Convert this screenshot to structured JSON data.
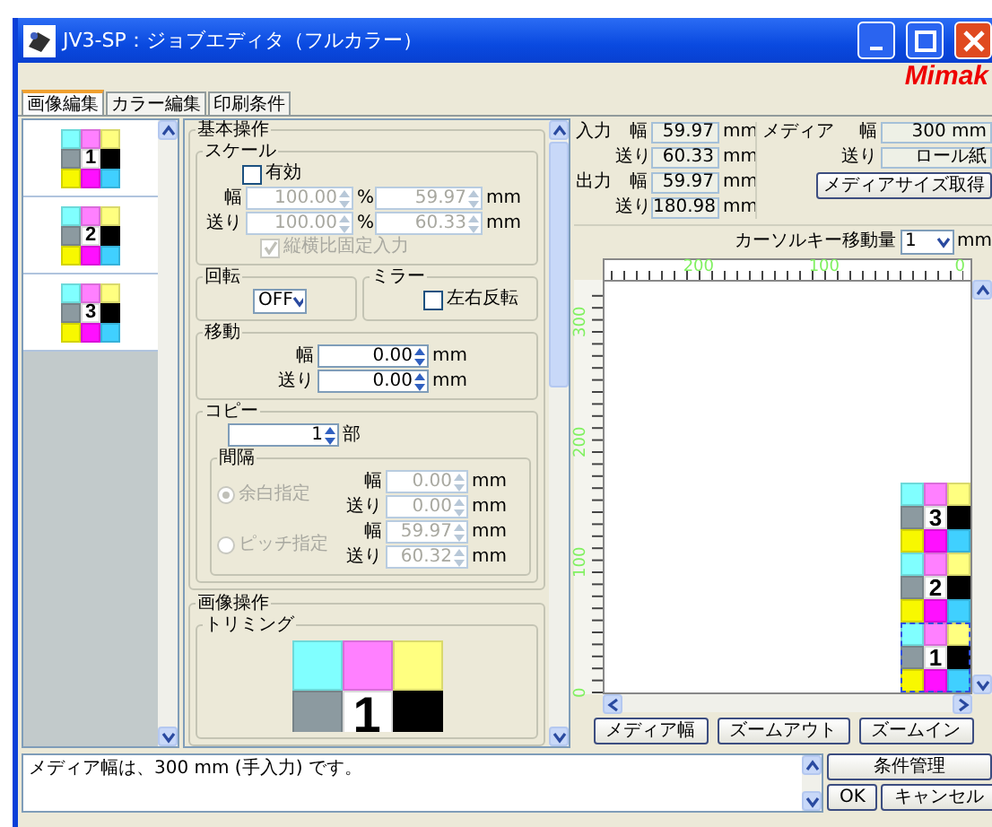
{
  "window": {
    "title": "JV3-SP：ジョブエディタ（フルカラー）",
    "logo": "Mimak"
  },
  "tabs": [
    {
      "label": "画像編集",
      "selected": true
    },
    {
      "label": "カラー編集",
      "selected": false
    },
    {
      "label": "印刷条件",
      "selected": false
    }
  ],
  "thumbnails": [
    {
      "number": "1"
    },
    {
      "number": "2"
    },
    {
      "number": "3"
    }
  ],
  "basic_ops": {
    "title": "基本操作",
    "scale": {
      "title": "スケール",
      "enabled": {
        "label": "有効",
        "checked": false
      },
      "rows": [
        {
          "label": "幅",
          "percent": "100.00",
          "percent_unit": "%",
          "value": "59.97",
          "unit": "mm"
        },
        {
          "label": "送り",
          "percent": "100.00",
          "percent_unit": "%",
          "value": "60.33",
          "unit": "mm"
        }
      ],
      "aspect_lock": {
        "label": "縦横比固定入力",
        "checked": true
      }
    },
    "rotation": {
      "title": "回転",
      "value": "OFF"
    },
    "mirror": {
      "title": "ミラー",
      "checkbox": {
        "label": "左右反転",
        "checked": false
      }
    },
    "move": {
      "title": "移動",
      "rows": [
        {
          "label": "幅",
          "value": "0.00",
          "unit": "mm"
        },
        {
          "label": "送り",
          "value": "0.00",
          "unit": "mm"
        }
      ]
    },
    "copy": {
      "title": "コピー",
      "count": "1",
      "count_unit": "部",
      "interval": {
        "title": "間隔",
        "options": [
          {
            "label": "余白指定",
            "selected": true,
            "rows": [
              {
                "label": "幅",
                "value": "0.00",
                "unit": "mm"
              },
              {
                "label": "送り",
                "value": "0.00",
                "unit": "mm"
              }
            ]
          },
          {
            "label": "ピッチ指定",
            "selected": false,
            "rows": [
              {
                "label": "幅",
                "value": "59.97",
                "unit": "mm"
              },
              {
                "label": "送り",
                "value": "60.32",
                "unit": "mm"
              }
            ]
          }
        ]
      }
    }
  },
  "image_ops": {
    "title": "画像操作",
    "trimming": {
      "title": "トリミング",
      "number": "1"
    }
  },
  "size_info": {
    "groups": [
      {
        "label": "入力",
        "rows": [
          {
            "label": "幅",
            "value": "59.97",
            "unit": "mm"
          },
          {
            "label": "送り",
            "value": "60.33",
            "unit": "mm"
          }
        ]
      },
      {
        "label": "出力",
        "rows": [
          {
            "label": "幅",
            "value": "59.97",
            "unit": "mm"
          },
          {
            "label": "送り",
            "value": "180.98",
            "unit": "mm"
          }
        ]
      }
    ],
    "media": {
      "label": "メディア",
      "rows": [
        {
          "label": "幅",
          "value": "300 mm"
        },
        {
          "label": "送り",
          "value": "ロール紙"
        }
      ],
      "button": "メディアサイズ取得"
    }
  },
  "cursor_step": {
    "label": "カーソルキー移動量",
    "value": "1",
    "unit": "mm"
  },
  "preview": {
    "x_ruler": [
      "200",
      "100",
      "0"
    ],
    "y_ruler": [
      "300",
      "200",
      "100",
      "0"
    ],
    "tiles": [
      {
        "number": "3",
        "selected": false
      },
      {
        "number": "2",
        "selected": false
      },
      {
        "number": "1",
        "selected": true
      }
    ],
    "buttons": [
      "メディア幅",
      "ズームアウト",
      "ズームイン"
    ]
  },
  "message": "メディア幅は、300 mm (手入力) です。",
  "actions": {
    "manage": "条件管理",
    "ok": "OK",
    "cancel": "キャンセル"
  }
}
